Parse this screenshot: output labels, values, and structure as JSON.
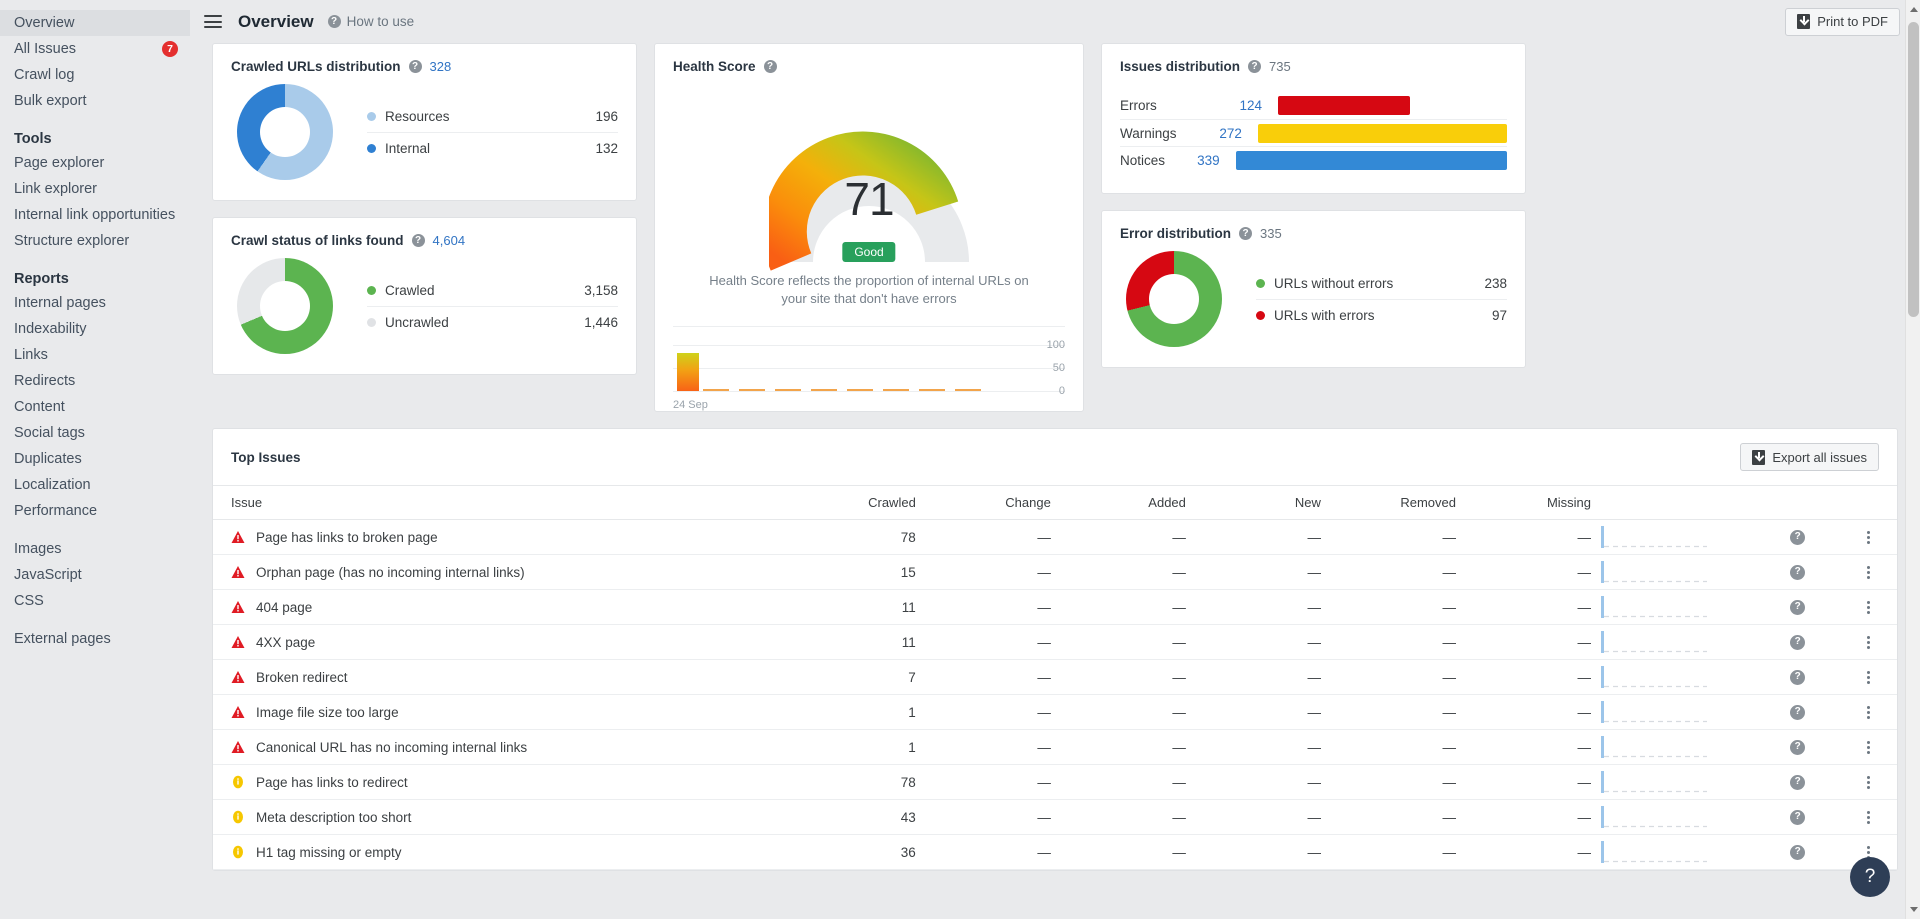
{
  "sidebar": {
    "items": [
      {
        "label": "Overview",
        "active": true,
        "badge": null
      },
      {
        "label": "All Issues",
        "active": false,
        "badge": "7"
      },
      {
        "label": "Crawl log",
        "active": false,
        "badge": null
      },
      {
        "label": "Bulk export",
        "active": false,
        "badge": null
      }
    ],
    "tools_heading": "Tools",
    "tools": [
      {
        "label": "Page explorer"
      },
      {
        "label": "Link explorer"
      },
      {
        "label": "Internal link opportunities"
      },
      {
        "label": "Structure explorer"
      }
    ],
    "reports_heading": "Reports",
    "reports": [
      {
        "label": "Internal pages"
      },
      {
        "label": "Indexability"
      },
      {
        "label": "Links"
      },
      {
        "label": "Redirects"
      },
      {
        "label": "Content"
      },
      {
        "label": "Social tags"
      },
      {
        "label": "Duplicates"
      },
      {
        "label": "Localization"
      },
      {
        "label": "Performance"
      }
    ],
    "assets": [
      {
        "label": "Images"
      },
      {
        "label": "JavaScript"
      },
      {
        "label": "CSS"
      }
    ],
    "extra": [
      {
        "label": "External pages"
      }
    ]
  },
  "header": {
    "menu_icon": "hamburger-icon",
    "title": "Overview",
    "how_to_use": "How to use",
    "print_button": "Print to PDF"
  },
  "crawled_urls": {
    "title": "Crawled URLs distribution",
    "total": "328",
    "legend": [
      {
        "label": "Resources",
        "value": "196",
        "color": "#a9cbea"
      },
      {
        "label": "Internal",
        "value": "132",
        "color": "#2f80d2"
      }
    ]
  },
  "crawl_status": {
    "title": "Crawl status of links found",
    "total": "4,604",
    "legend": [
      {
        "label": "Crawled",
        "value": "3,158",
        "color": "#5cb450"
      },
      {
        "label": "Uncrawled",
        "value": "1,446",
        "color": "#e6e8ea"
      }
    ]
  },
  "health_score": {
    "title": "Health Score",
    "score": "71",
    "rating": "Good",
    "rating_color": "#28a05c",
    "description": "Health Score reflects the proportion of internal URLs on your site that don't have errors",
    "mini_chart_ticks": [
      "100",
      "50",
      "0"
    ],
    "mini_chart_date": "24 Sep"
  },
  "issues_distribution": {
    "title": "Issues distribution",
    "total": "735",
    "rows": [
      {
        "label": "Errors",
        "value": "124",
        "color": "#d60812",
        "width_pct": 34
      },
      {
        "label": "Warnings",
        "value": "272",
        "color": "#f9ce0a",
        "width_pct": 75
      },
      {
        "label": "Notices",
        "value": "339",
        "color": "#3389d6",
        "width_pct": 100
      }
    ]
  },
  "error_distribution": {
    "title": "Error distribution",
    "total": "335",
    "legend": [
      {
        "label": "URLs without errors",
        "value": "238",
        "color": "#5cb450"
      },
      {
        "label": "URLs with errors",
        "value": "97",
        "color": "#d60812"
      }
    ]
  },
  "top_issues": {
    "title": "Top Issues",
    "export_button": "Export all issues",
    "columns": [
      "Issue",
      "Crawled",
      "Change",
      "Added",
      "New",
      "Removed",
      "Missing"
    ],
    "rows": [
      {
        "severity": "error",
        "issue": "Page has links to broken page",
        "crawled": "78",
        "change": "—",
        "added": "—",
        "new": "—",
        "removed": "—",
        "missing": "—"
      },
      {
        "severity": "error",
        "issue": "Orphan page (has no incoming internal links)",
        "crawled": "15",
        "change": "—",
        "added": "—",
        "new": "—",
        "removed": "—",
        "missing": "—"
      },
      {
        "severity": "error",
        "issue": "404 page",
        "crawled": "11",
        "change": "—",
        "added": "—",
        "new": "—",
        "removed": "—",
        "missing": "—"
      },
      {
        "severity": "error",
        "issue": "4XX page",
        "crawled": "11",
        "change": "—",
        "added": "—",
        "new": "—",
        "removed": "—",
        "missing": "—"
      },
      {
        "severity": "error",
        "issue": "Broken redirect",
        "crawled": "7",
        "change": "—",
        "added": "—",
        "new": "—",
        "removed": "—",
        "missing": "—"
      },
      {
        "severity": "error",
        "issue": "Image file size too large",
        "crawled": "1",
        "change": "—",
        "added": "—",
        "new": "—",
        "removed": "—",
        "missing": "—"
      },
      {
        "severity": "error",
        "issue": "Canonical URL has no incoming internal links",
        "crawled": "1",
        "change": "—",
        "added": "—",
        "new": "—",
        "removed": "—",
        "missing": "—"
      },
      {
        "severity": "warning",
        "issue": "Page has links to redirect",
        "crawled": "78",
        "change": "—",
        "added": "—",
        "new": "—",
        "removed": "—",
        "missing": "—"
      },
      {
        "severity": "warning",
        "issue": "Meta description too short",
        "crawled": "43",
        "change": "—",
        "added": "—",
        "new": "—",
        "removed": "—",
        "missing": "—"
      },
      {
        "severity": "warning",
        "issue": "H1 tag missing or empty",
        "crawled": "36",
        "change": "—",
        "added": "—",
        "new": "—",
        "removed": "—",
        "missing": "—"
      }
    ]
  },
  "help_fab": "?",
  "chart_data": [
    {
      "type": "pie",
      "title": "Crawled URLs distribution",
      "labels": [
        "Resources",
        "Internal"
      ],
      "values": [
        196,
        132
      ],
      "colors": [
        "#a9cbea",
        "#2f80d2"
      ],
      "total": 328,
      "legend": "right"
    },
    {
      "type": "pie",
      "title": "Crawl status of links found",
      "labels": [
        "Crawled",
        "Uncrawled"
      ],
      "values": [
        3158,
        1446
      ],
      "colors": [
        "#5cb450",
        "#e6e8ea"
      ],
      "total": 4604,
      "legend": "right"
    },
    {
      "type": "bar",
      "title": "Issues distribution",
      "categories": [
        "Errors",
        "Warnings",
        "Notices"
      ],
      "values": [
        124,
        272,
        339
      ],
      "colors": [
        "#d60812",
        "#f9ce0a",
        "#3389d6"
      ],
      "total": 735,
      "orientation": "horizontal",
      "xlabel": "",
      "ylabel": "",
      "grid": false
    },
    {
      "type": "pie",
      "title": "Error distribution",
      "labels": [
        "URLs without errors",
        "URLs with errors"
      ],
      "values": [
        238,
        97
      ],
      "colors": [
        "#5cb450",
        "#d60812"
      ],
      "total": 335,
      "legend": "right"
    },
    {
      "type": "bar",
      "title": "Health Score history",
      "categories": [
        "24 Sep"
      ],
      "values": [
        71
      ],
      "ylim": [
        0,
        100
      ],
      "yticks": [
        0,
        50,
        100
      ],
      "ylabel": "",
      "xlabel": "",
      "grid": true
    }
  ]
}
